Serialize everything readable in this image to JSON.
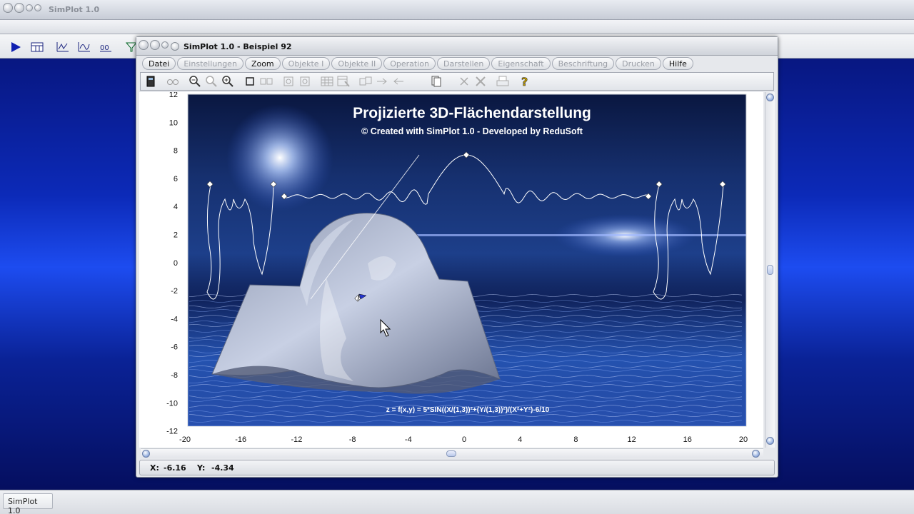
{
  "app": {
    "title": "SimPlot 1.0",
    "taskbar_label": "SimPlot 1.0"
  },
  "window": {
    "title": "SimPlot 1.0 - Beispiel 92"
  },
  "menu": [
    {
      "label": "Datei",
      "enabled": true
    },
    {
      "label": "Einstellungen",
      "enabled": false
    },
    {
      "label": "Zoom",
      "enabled": true
    },
    {
      "label": "Objekte I",
      "enabled": false
    },
    {
      "label": "Objekte II",
      "enabled": false
    },
    {
      "label": "Operation",
      "enabled": false
    },
    {
      "label": "Darstellen",
      "enabled": false
    },
    {
      "label": "Eigenschaft",
      "enabled": false
    },
    {
      "label": "Beschriftung",
      "enabled": false
    },
    {
      "label": "Drucken",
      "enabled": false
    },
    {
      "label": "Hilfe",
      "enabled": true
    }
  ],
  "plot": {
    "title": "Projizierte 3D-Flächendarstellung",
    "subtitle": "© Created with SimPlot 1.0 - Developed by ReduSoft",
    "formula": "z = f(x,y) = 5*SIN((X/(1,3))²+(Y/(1,3))²)/(X²+Y²)-6/10",
    "y_ticks": [
      "12",
      "10",
      "8",
      "6",
      "4",
      "2",
      "0",
      "-2",
      "-4",
      "-6",
      "-8",
      "-10",
      "-12"
    ],
    "x_ticks": [
      "-20",
      "-16",
      "-12",
      "-8",
      "-4",
      "0",
      "4",
      "8",
      "12",
      "16",
      "20"
    ]
  },
  "status": {
    "x_label": "X:",
    "x_value": "-6.16",
    "y_label": "Y:",
    "y_value": "-4.34"
  },
  "colors": {
    "desktop": "#0c2ab8",
    "accent": "#2233aa"
  }
}
